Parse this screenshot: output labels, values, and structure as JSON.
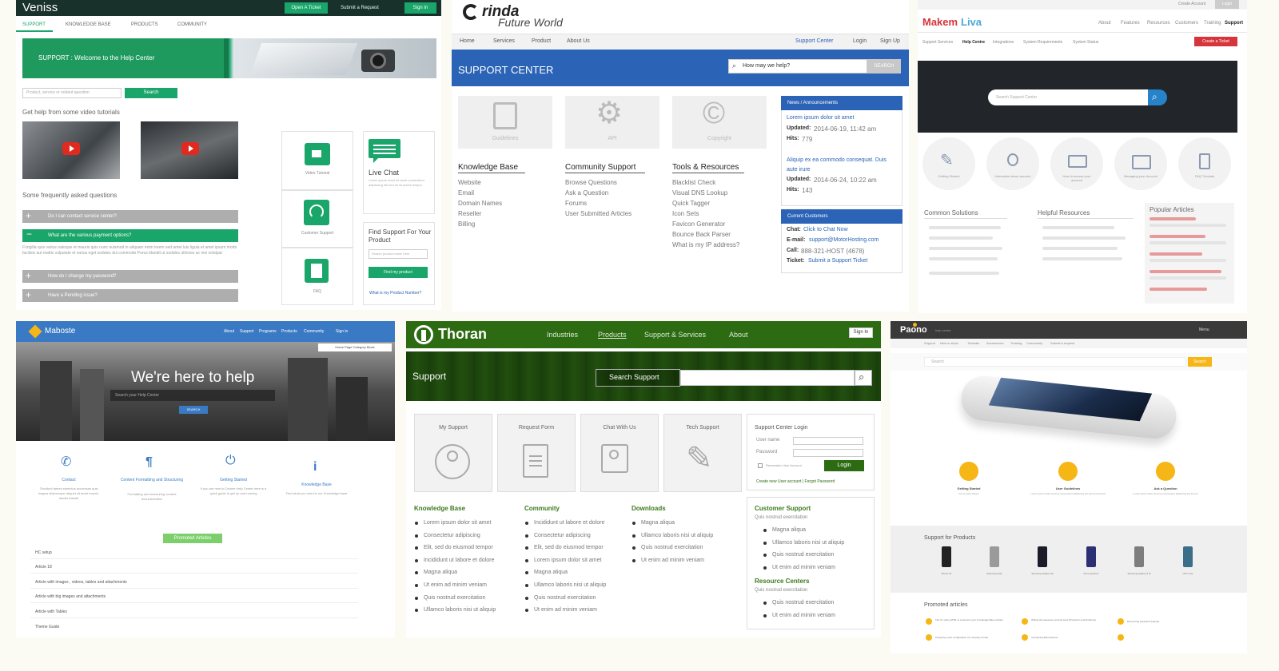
{
  "colors": {
    "veniss_green": "#1aa56b",
    "orinda_blue": "#2b63b6",
    "thoran_green": "#2c6b12",
    "makem_red": "#d6353c",
    "maboste_blue": "#3a7ac4",
    "paono_yellow": "#f5b616"
  },
  "veniss": {
    "logo": "Veniss",
    "top_buttons": [
      "Open A Ticket",
      "Submit a Request",
      "Sign In"
    ],
    "nav": [
      "SUPPORT",
      "KNOWLEDGE BASE",
      "PRODUCTS",
      "COMMUNITY"
    ],
    "hero": "SUPPORT : Welcome to the Help Center",
    "search_placeholder": "Product, service or related question",
    "search_button": "Search",
    "videos_heading": "Get help from some video tutorials",
    "faq_heading": "Some frequently asked questions",
    "faqs": [
      "Do I can contact service center?",
      "What are the various payment options?",
      "How do I change my password?",
      "Have a Pending issue?"
    ],
    "faq_answer": "Fringilla quis varius natoque et mauris quis nunc euismod in aliquam enim lorem sed amet luis ligula et amet ipsum morbi facilisis aut mattis vulputate et varius eget sodales dui commodo Purus blandit ut sodales ultricies ac nisi volutpat",
    "tiles": [
      "Video Tutorial",
      "Live Chat",
      "Customer Support",
      "FAQ"
    ],
    "live_chat_text": "Lorem ipsum dolor sit amet consectetur adipiscing elit sed do eiusmod tempor",
    "find_title": "Find Support For Your Product",
    "find_placeholder": "Search product name here",
    "find_button": "Find my product",
    "find_link": "What is my Product Number?"
  },
  "orinda": {
    "logo": "rinda",
    "tagline": "Future World",
    "nav": [
      "Home",
      "Services",
      "Product",
      "About Us"
    ],
    "nav_right": [
      "Support Center",
      "Login",
      "Sign Up"
    ],
    "banner": "SUPPORT CENTER",
    "search_placeholder": "How may we help?",
    "search_button": "SEARCH",
    "icons": [
      "Guidelines",
      "API",
      "Copyright"
    ],
    "columns": [
      {
        "title": "Knowledge Base",
        "items": [
          "Website",
          "Email",
          "Domain Names",
          "Reseller",
          "Billing"
        ]
      },
      {
        "title": "Community Support",
        "items": [
          "Browse Questions",
          "Ask a Question",
          "Forums",
          "User Submitted Articles"
        ]
      },
      {
        "title": "Tools & Resources",
        "items": [
          "Blacklist Check",
          "Visual DNS Lookup",
          "Quick Tagger",
          "Icon Sets",
          "Favicon Generator",
          "Bounce Back Parser",
          "What is my IP address?"
        ]
      }
    ],
    "news_title": "News / Announcements",
    "news": [
      {
        "link": "Lorem ipsum dolor sit amet",
        "updated_label": "Updated:",
        "updated": "2014-06-19, 11:42 am",
        "hits_label": "Hits:",
        "hits": "779"
      },
      {
        "link": "Aliquip ex ea commodo consequat. Duis aute irure",
        "updated_label": "Updated:",
        "updated": "2014-06-24, 10:22 am",
        "hits_label": "Hits:",
        "hits": "143"
      }
    ],
    "customers_title": "Current Customers",
    "contacts": [
      {
        "label": "Chat:",
        "value": "Click to Chat Now"
      },
      {
        "label": "E-mail:",
        "value": "support@MotorHosting.com"
      },
      {
        "label": "Call:",
        "value": "888-321-HOST (4678)"
      },
      {
        "label": "Ticket:",
        "value": "Submit a Support Ticket"
      }
    ]
  },
  "makem": {
    "logo_a": "Makem",
    "logo_b": "Liva",
    "top_links": [
      "Create Account",
      "Login"
    ],
    "nav": [
      "About",
      "Features",
      "Resources",
      "Customers",
      "Training",
      "Support"
    ],
    "sub_nav": [
      "Support Services",
      "Help Centre",
      "Integrations",
      "System Requirements",
      "System Status"
    ],
    "button": "Create a Ticket",
    "search_placeholder": "Search Support Center",
    "icons": [
      "Getting Started",
      "Infomation about account",
      "How to access your account",
      "Managing your Account",
      "FAQ Tutorials"
    ],
    "col_titles": [
      "Common Solutions",
      "Helpful Resources",
      "Popular Articles"
    ]
  },
  "maboste": {
    "logo": "Maboste",
    "nav": [
      "About",
      "Support",
      "Programs",
      "Products",
      "Community",
      "Sign in"
    ],
    "breadcrumb": "Home Page Category Block",
    "hero": "We're here to help",
    "search_placeholder": "Search your Help Center",
    "search_button": "SEARCH",
    "features": [
      {
        "title": "Contact",
        "text": "Tincidunt fames senectus accumsan quis magna ullamcorper aliquet sit amet mauris. Iaculis blandit"
      },
      {
        "title": "Content Formatting and Structuring",
        "text": "Formatting and structuring content documentation"
      },
      {
        "title": "Getting Started",
        "text": "If you are new to Octane Help Center here is a quick guide to get up and running"
      },
      {
        "title": "Knowledge Base",
        "text": "Find what you need in our Knowledge base"
      }
    ],
    "promoted": "Promoted Articles",
    "articles": [
      "HC setup",
      "Article 18",
      "Article with images , videos, tables and attachments",
      "Article with big images and attachments",
      "Article with Tables",
      "Theme Guide"
    ]
  },
  "thoran": {
    "logo": "Thoran",
    "nav": [
      "Industries",
      "Products",
      "Support & Services",
      "About"
    ],
    "sign_in": "Sign In",
    "banner": "Support",
    "search_label": "Search Support",
    "cards": [
      "My Support",
      "Request Form",
      "Chat With Us",
      "Tech Support"
    ],
    "login_title": "Support Center Login",
    "user_label": "User name",
    "pass_label": "Password",
    "remember": "Remember User Account",
    "login_button": "Login",
    "login_links": "Create new User account | Forgot Password",
    "columns": [
      {
        "title": "Knowledge Base",
        "items": [
          "Lorem ipsum dolor sit amet",
          "Consectetur adipiscing",
          "Elit, sed do eiusmod tempor",
          "Incididunt ut labore et dolore",
          "Magna aliqua",
          "Ut enim ad minim veniam",
          "Quis nostrud exercitation",
          "Ullamco laboris nisi ut aliquip"
        ]
      },
      {
        "title": "Community",
        "items": [
          "Incididunt ut labore et dolore",
          "Consectetur adipiscing",
          "Elit, sed do eiusmod tempor",
          "Lorem ipsum dolor sit amet",
          "Magna aliqua",
          "Ullamco laboris nisi ut aliquip",
          "Quis nostrud exercitation",
          "Ut enim ad minim veniam"
        ]
      },
      {
        "title": "Downloads",
        "items": [
          "Magna aliqua",
          "Ullamco laboris nisi ut aliquip",
          "Quis nostrud exercitation",
          "Ut enim ad minim veniam"
        ]
      }
    ],
    "cs_title": "Customer Support",
    "cs_sub": "Quis nostrud exercitation",
    "cs_items": [
      "Magna aliqua",
      "Ullamco laboris nisi ut aliquip",
      "Quis nostrud exercitation",
      "Ut enim ad minim veniam"
    ],
    "rc_title": "Resource Centers",
    "rc_sub": "Quis nostrud exercitation",
    "rc_items": [
      "Quis nostrud exercitation",
      "Ut enim ad minim veniam"
    ]
  },
  "paono": {
    "logo": "Paono",
    "logo_sub": "help center",
    "menu": "Menu",
    "nav": [
      "Support",
      "New in stock",
      "Tutorials",
      "Accessories",
      "Training",
      "Community",
      "Submit a request"
    ],
    "search_placeholder": "Search",
    "search_button": "Search",
    "features": [
      {
        "title": "Getting Started",
        "text": "Get to know Paono"
      },
      {
        "title": "User Guidelines",
        "text": "Lorem ipsum dolor sit amet consectetur adipiscing elit sed do eiusmod"
      },
      {
        "title": "Ask a Question",
        "text": "Lorem ipsum dolor sit amet consectetur adipiscing elit sed do"
      }
    ],
    "products_title": "Support for Products",
    "products": [
      "Phone 6s",
      "Samsung Note",
      "Samsung Galaxy S6",
      "Sony Xperia Z",
      "Samsung Galaxy S III",
      "HTC One"
    ],
    "promoted_title": "Promoted articles",
    "articles": [
      "Tips for using HTML to customize your Knowledge Base articles",
      "Writing the awesome security level (Protection and Enhance)",
      "Recovering password settings",
      "Preparing a doc configuration for company format",
      "Introducing Beta features"
    ]
  }
}
